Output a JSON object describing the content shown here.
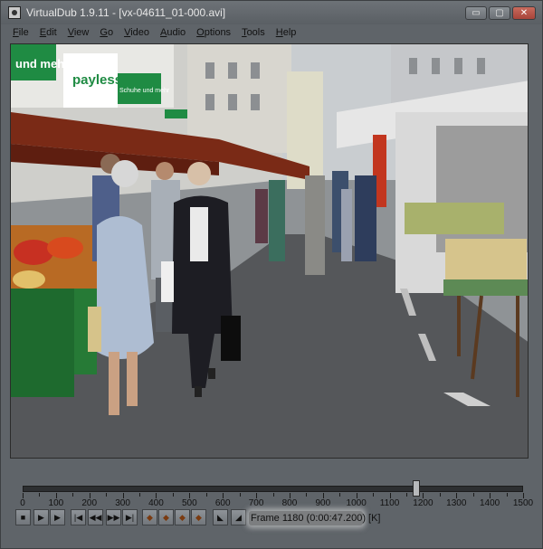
{
  "window": {
    "title": "VirtualDub 1.9.11 - [vx-04611_01-000.avi]",
    "buttons": {
      "minimize": "▭",
      "maximize": "▢",
      "close": "✕"
    }
  },
  "menu": [
    "File",
    "Edit",
    "View",
    "Go",
    "Video",
    "Audio",
    "Options",
    "Tools",
    "Help"
  ],
  "video": {
    "description_signs": [
      "und mehr",
      "payless",
      "Schuhe und mehr"
    ]
  },
  "timeline": {
    "labels": [
      "0",
      "100",
      "200",
      "300",
      "400",
      "500",
      "600",
      "700",
      "800",
      "900",
      "1000",
      "1100",
      "1200",
      "1300",
      "1400",
      "1500"
    ],
    "max": 1500,
    "position": 1180
  },
  "toolbar": {
    "buttons": [
      {
        "name": "stop-icon",
        "glyph": "■"
      },
      {
        "name": "play-input-icon",
        "glyph": "▶"
      },
      {
        "name": "play-output-icon",
        "glyph": "▶"
      },
      {
        "name": "start-icon",
        "glyph": "|◀"
      },
      {
        "name": "back-icon",
        "glyph": "◀◀"
      },
      {
        "name": "forward-icon",
        "glyph": "▶▶"
      },
      {
        "name": "end-icon",
        "glyph": "▶|"
      },
      {
        "name": "prev-key-icon",
        "glyph": "◆"
      },
      {
        "name": "next-key-icon",
        "glyph": "◆"
      },
      {
        "name": "prev-scene-icon",
        "glyph": "◆"
      },
      {
        "name": "next-scene-icon",
        "glyph": "◆"
      },
      {
        "name": "mark-in-icon",
        "glyph": "◣"
      },
      {
        "name": "mark-out-icon",
        "glyph": "◢"
      }
    ]
  },
  "status": {
    "frame_text": "Frame 1180 (0:00:47.200) [K]"
  }
}
